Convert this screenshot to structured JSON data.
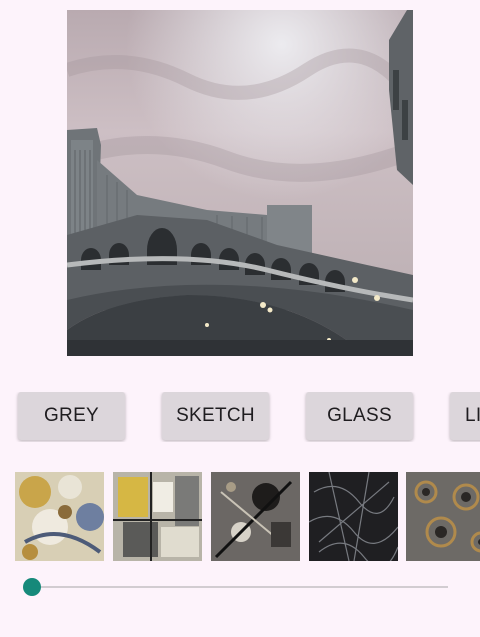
{
  "photo": {
    "description": "Venetian hotel replica of the Rialto Bridge under a cloudy sky"
  },
  "filters": [
    {
      "label": "GREY"
    },
    {
      "label": "SKETCH"
    },
    {
      "label": "GLASS"
    },
    {
      "label": "LI"
    }
  ],
  "styles": [
    {
      "name": "style-thumbnail-1",
      "palette": "cream-yellow-blue abstract"
    },
    {
      "name": "style-thumbnail-2",
      "palette": "yellow-grey cubist"
    },
    {
      "name": "style-thumbnail-3",
      "palette": "grey-black kandinsky"
    },
    {
      "name": "style-thumbnail-4",
      "palette": "dark scribble"
    },
    {
      "name": "style-thumbnail-5",
      "palette": "bronze circles"
    }
  ],
  "slider": {
    "value": 0,
    "min": 0,
    "max": 100
  },
  "colors": {
    "background": "#fdf3fb",
    "button": "#dcd6db",
    "accent": "#16897a"
  }
}
